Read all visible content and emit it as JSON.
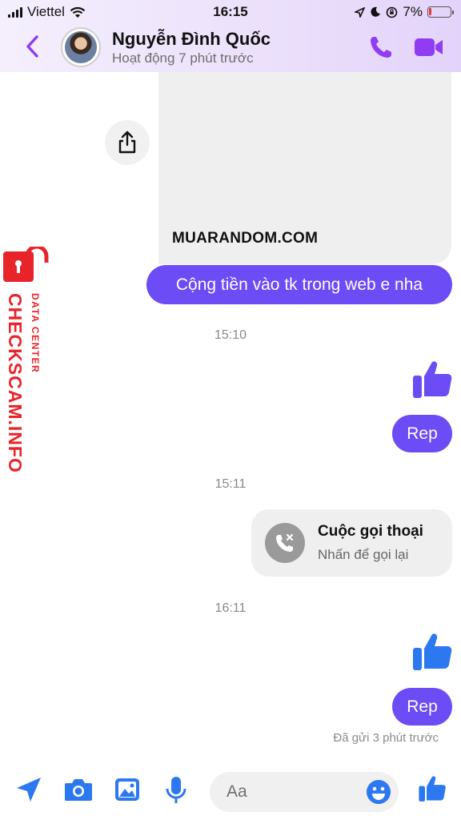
{
  "status_bar": {
    "carrier": "Viettel",
    "time": "16:15",
    "battery": "7%"
  },
  "header": {
    "contact_name": "Nguyễn Đình Quốc",
    "activity": "Hoạt động 7 phút trước"
  },
  "messages": {
    "link_preview_site": "MUARANDOM.COM",
    "outgoing_text_1": "Cộng tiền vào tk trong web e nha",
    "time_1": "15:10",
    "rep_1": "Rep",
    "time_2": "15:11",
    "call_title": "Cuộc gọi thoại",
    "call_subtitle": "Nhấn để gọi lại",
    "time_3": "16:11",
    "rep_2": "Rep",
    "sent_status": "Đã gửi 3 phút trước"
  },
  "watermark": {
    "brand": "CHECKSCAM.INFO",
    "subtitle": "DATA CENTER"
  },
  "composer": {
    "placeholder": "Aa"
  },
  "colors": {
    "accent": "#6b4cf5",
    "icon_purple": "#8f3cf2",
    "icon_blue": "#2b78f0",
    "watermark_red": "#e8232a"
  },
  "icons": [
    "back-chevron-icon",
    "phone-icon",
    "video-camera-icon",
    "share-icon",
    "thumbs-up-icon",
    "missed-call-icon",
    "send-location-icon",
    "camera-icon",
    "photo-icon",
    "microphone-icon",
    "emoji-icon",
    "lock-icon"
  ]
}
